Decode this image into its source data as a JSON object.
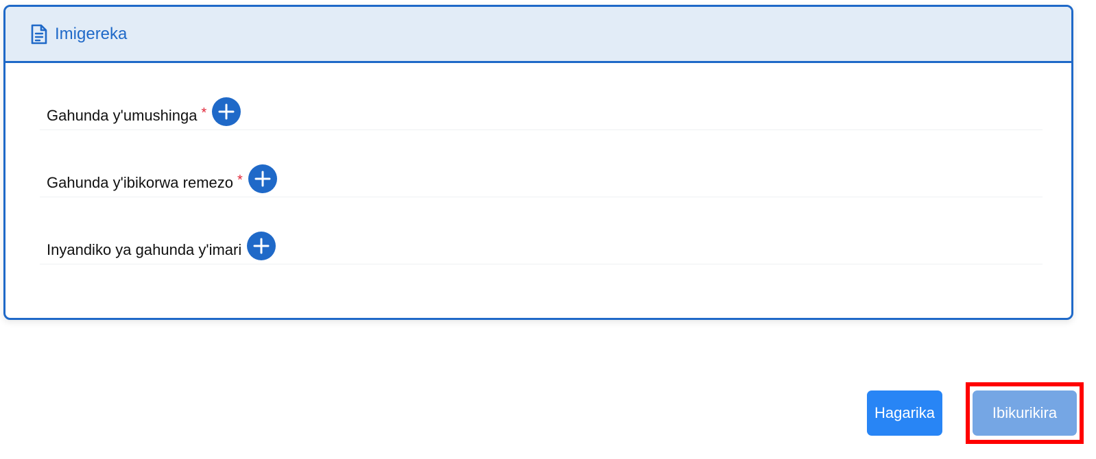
{
  "card": {
    "title": "Imigereka",
    "icon": "document-icon"
  },
  "rows": [
    {
      "label": "Gahunda y'umushinga",
      "required": true,
      "required_mark": "*",
      "action_icon": "plus-circle-icon"
    },
    {
      "label": "Gahunda y'ibikorwa remezo",
      "required": true,
      "required_mark": "*",
      "action_icon": "plus-circle-icon"
    },
    {
      "label": "Inyandiko ya gahunda y'imari",
      "required": false,
      "action_icon": "plus-circle-icon"
    }
  ],
  "footer": {
    "cancel_label": "Hagarika",
    "submit_label": "Ibikurikira"
  },
  "colors": {
    "accent": "#1f69c8",
    "header_bg": "#e2ecf7",
    "required": "#e1283a",
    "cancel_bg": "#2885f5",
    "submit_bg": "#75a6e4",
    "highlight": "#ff0000"
  }
}
